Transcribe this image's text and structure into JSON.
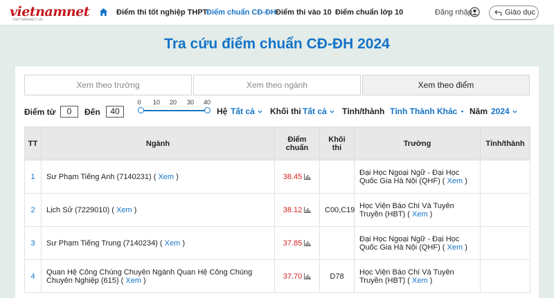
{
  "site": {
    "logo_text": "vietnamnet",
    "logo_sub": "VIETNAMNET.VN"
  },
  "nav": {
    "items": [
      {
        "label": "Điểm thi tốt nghiệp THPT"
      },
      {
        "label": "Điểm chuẩn CĐ-ĐH"
      },
      {
        "label": "Điểm thi vào 10"
      },
      {
        "label": "Điểm chuẩn lớp 10"
      }
    ],
    "active_index": 1,
    "login_label": "Đăng nhập",
    "back_button_label": "Giáo dục"
  },
  "page": {
    "title": "Tra cứu điểm chuẩn CĐ-ĐH 2024"
  },
  "tabs": [
    {
      "label": "Xem theo trường"
    },
    {
      "label": "Xem theo ngành"
    },
    {
      "label": "Xem theo điểm"
    }
  ],
  "active_tab": 2,
  "filters": {
    "score_from_label": "Điểm từ",
    "score_from_value": "0",
    "score_to_label": "Đến",
    "score_to_value": "40",
    "slider_ticks": [
      "0",
      "10",
      "20",
      "30",
      "40"
    ],
    "he_label": "Hệ",
    "he_value": "Tất cả",
    "khoi_label": "Khối thi",
    "khoi_value": "Tất cả",
    "tinh_label": "Tỉnh/thành",
    "tinh_value": "Tỉnh Thành Khác",
    "nam_label": "Năm",
    "nam_value": "2024"
  },
  "table": {
    "headers": {
      "tt": "TT",
      "nganh": "Ngành",
      "diem_1": "Điểm",
      "diem_2": "chuẩn",
      "khoi_1": "Khối",
      "khoi_2": "thi",
      "truong": "Trường",
      "tinh": "Tỉnh/thành"
    },
    "xem_label": "Xem",
    "rows": [
      {
        "tt": "1",
        "nganh": "Sư Phạm Tiếng Anh (7140231)",
        "diem": "38.45",
        "khoi": "",
        "truong": "Đại Học Ngoại Ngữ - Đại Học Quốc Gia Hà Nội (QHF)",
        "tinh": ""
      },
      {
        "tt": "2",
        "nganh": "Lịch Sử (7229010)",
        "diem": "38.12",
        "khoi": "C00,C19",
        "truong": "Học Viện Báo Chí Và Tuyên Truyền (HBT)",
        "tinh": ""
      },
      {
        "tt": "3",
        "nganh": "Sư Phạm Tiếng Trung (7140234)",
        "diem": "37.85",
        "khoi": "",
        "truong": "Đại Học Ngoại Ngữ - Đại Học Quốc Gia Hà Nội (QHF)",
        "tinh": ""
      },
      {
        "tt": "4",
        "nganh": "Quan Hệ Công Chúng Chuyên Ngành Quan Hệ Công Chúng Chuyên Nghiệp (615)",
        "diem": "37.70",
        "khoi": "D78",
        "truong": "Học Viện Báo Chí Và Tuyên Truyền (HBT)",
        "tinh": ""
      }
    ]
  },
  "colors": {
    "accent": "#1473c8",
    "brand_red": "#c4161c",
    "score_red": "#d32020",
    "page_bg": "#e3ece8"
  }
}
